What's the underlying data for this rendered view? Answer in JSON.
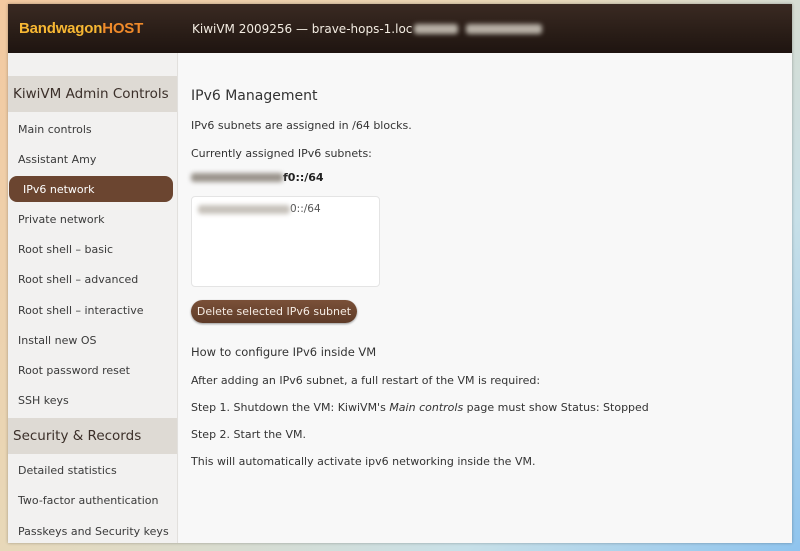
{
  "topbar": {
    "brand_part1": "Bandwagon",
    "brand_part2": "HOST",
    "vm_title": "KiwiVM 2009256 — brave-hops-1.loc"
  },
  "sidebar": {
    "section1_title": "KiwiVM Admin Controls",
    "items1": [
      {
        "label": "Main controls"
      },
      {
        "label": "Assistant Amy"
      },
      {
        "label": "IPv6 network",
        "active": true
      },
      {
        "label": "Private network"
      },
      {
        "label": "Root shell – basic"
      },
      {
        "label": "Root shell – advanced"
      },
      {
        "label": "Root shell – interactive"
      },
      {
        "label": "Install new OS"
      },
      {
        "label": "Root password reset"
      },
      {
        "label": "SSH keys"
      }
    ],
    "section2_title": "Security & Records",
    "items2": [
      {
        "label": "Detailed statistics"
      },
      {
        "label": "Two-factor authentication"
      },
      {
        "label": "Passkeys and Security keys"
      }
    ]
  },
  "main": {
    "title": "IPv6 Management",
    "intro": "IPv6 subnets are assigned in /64 blocks.",
    "assigned_label": "Currently assigned IPv6 subnets:",
    "assigned_subnet_suffix": "f0::/64",
    "list_option_suffix": "0::/64",
    "delete_button": "Delete selected IPv6 subnet",
    "howto_title": "How to configure IPv6 inside VM",
    "howto_intro": "After adding an IPv6 subnet, a full restart of the VM is required:",
    "step1_prefix": "Step 1. Shutdown the VM: KiwiVM's ",
    "step1_em": "Main controls",
    "step1_suffix": " page must show Status: Stopped",
    "step2": "Step 2. Start the VM.",
    "outro": "This will automatically activate ipv6 networking inside the VM."
  },
  "colors": {
    "accent": "#6b4530",
    "topbar": "#2a1d17",
    "brand_yellow": "#f7b733",
    "brand_orange": "#f08a2a"
  }
}
